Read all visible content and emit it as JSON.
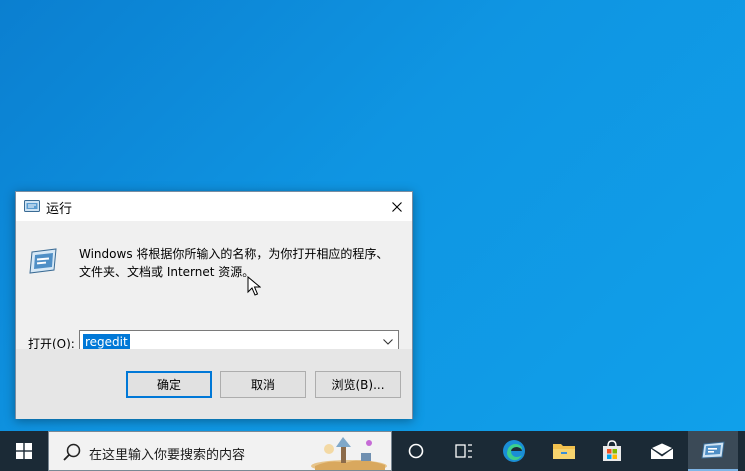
{
  "dialog": {
    "title": "运行",
    "description_line1": "Windows 将根据你所输入的名称，为你打开相应的程序、",
    "description_line2": "文件夹、文档或 Internet 资源。",
    "open_label": "打开(O):",
    "input_value": "regedit",
    "ok_label": "确定",
    "cancel_label": "取消",
    "browse_label": "浏览(B)..."
  },
  "taskbar": {
    "search_placeholder": "在这里输入你要搜索的内容",
    "items": [
      "start-icon",
      "cortana-icon",
      "task-view-icon",
      "edge-icon",
      "file-explorer-icon",
      "store-icon",
      "mail-icon",
      "run-icon"
    ]
  },
  "colors": {
    "desktop": "#0f95e2",
    "taskbar": "#1b2a36",
    "accent": "#0078d7"
  }
}
